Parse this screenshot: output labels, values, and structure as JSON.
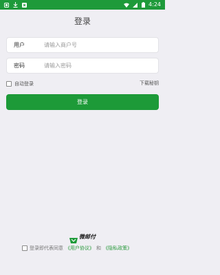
{
  "status_bar": {
    "time": "4:24",
    "icons": [
      "app-notification-icon",
      "download-icon",
      "close-square-icon",
      "wifi-icon",
      "signal-icon",
      "battery-icon"
    ]
  },
  "page": {
    "title": "登录"
  },
  "form": {
    "user_label": "用户",
    "user_placeholder": "请输入商户号",
    "user_value": "",
    "password_label": "密码",
    "password_placeholder": "请输入密码",
    "password_value": "",
    "remember_label": "自动登录",
    "remember_checked": false,
    "download_link": "下载秘钥",
    "login_button": "登录"
  },
  "footer": {
    "brand_name": "微邮付",
    "agree_prefix": "登录即代表同意",
    "user_agreement": "《用户协议》",
    "and_text": "和",
    "privacy_policy": "《隐私政策》",
    "agree_checked": false
  },
  "colors": {
    "accent": "#1d9a38",
    "status_bar": "#1e9a3a",
    "background": "#efeef3",
    "link": "#2a9a3c"
  }
}
